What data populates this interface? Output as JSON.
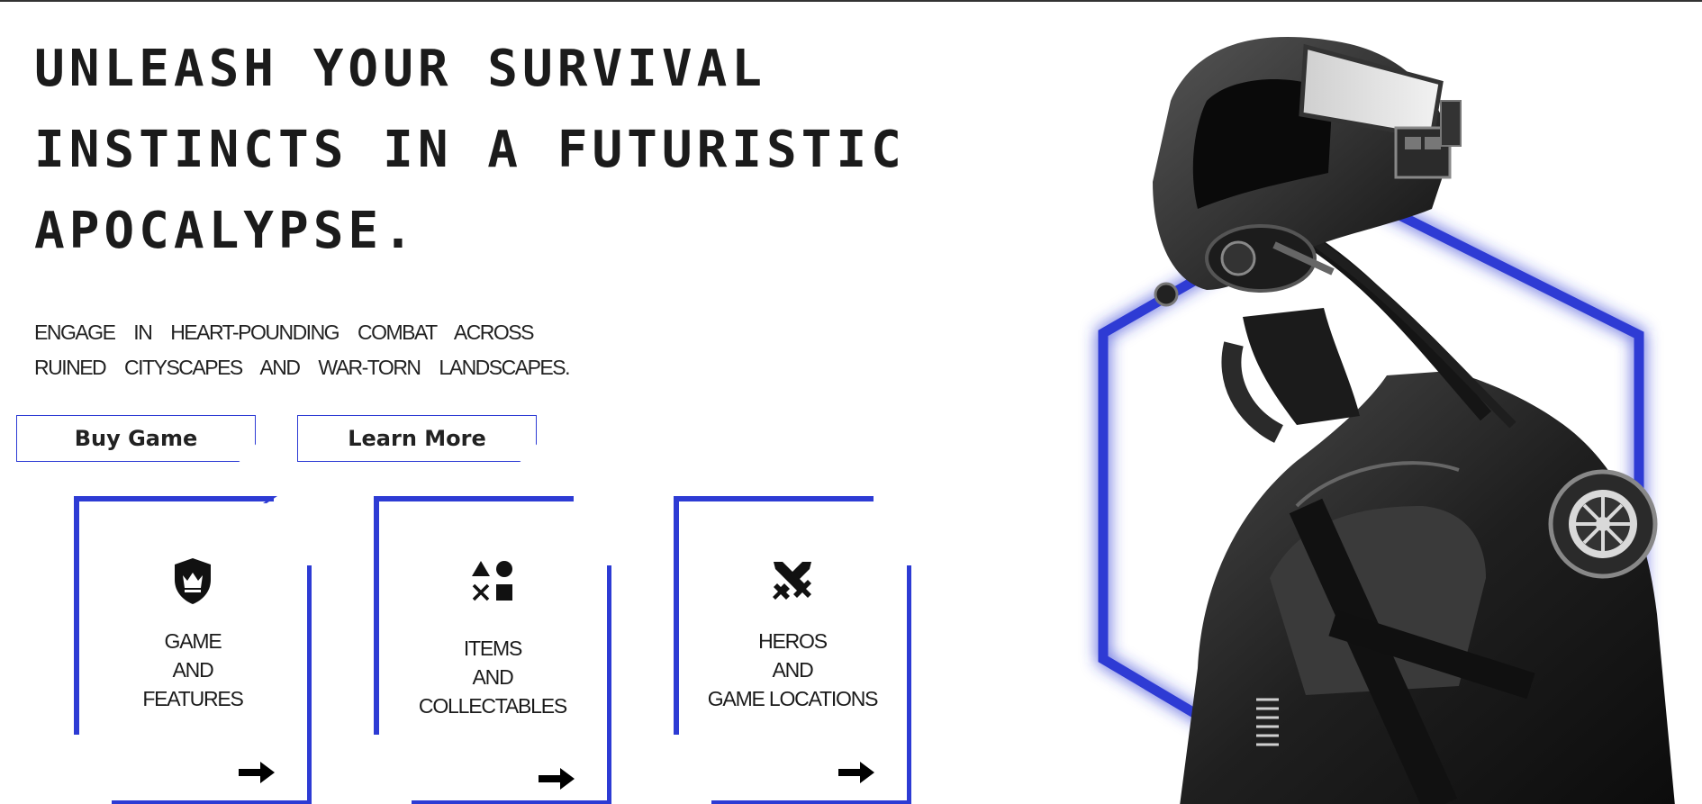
{
  "hero": {
    "title_lines": [
      "Unleash your survival",
      "instincts in a futuristic",
      "apocalypse."
    ],
    "subtitle_lines": [
      "Engage in heart-pounding combat across",
      "ruined cityscapes and war-torn landscapes."
    ]
  },
  "actions": {
    "buy_label": "Buy Game",
    "learn_label": "Learn More"
  },
  "cards": [
    {
      "lines": [
        "Game",
        "and",
        "Features"
      ],
      "icon": "shield-crown-icon"
    },
    {
      "lines": [
        "Items",
        "and",
        "Collectables"
      ],
      "icon": "shapes-icon"
    },
    {
      "lines": [
        "Heros",
        "and",
        "Game Locations"
      ],
      "icon": "crossed-swords-icon"
    }
  ],
  "colors": {
    "accent": "#2d3bd4",
    "glow": "#5c6cff",
    "text": "#1b1b1b",
    "background": "#ffffff"
  },
  "hero_image": {
    "icon": "armored-soldier-figure"
  }
}
